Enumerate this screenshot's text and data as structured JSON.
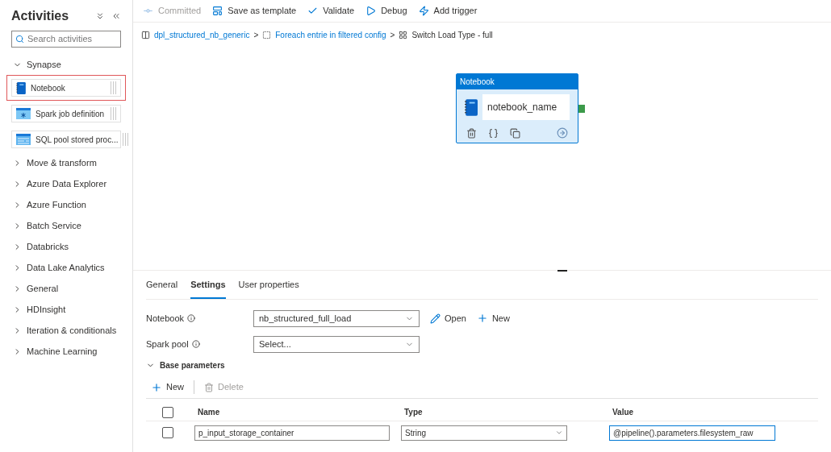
{
  "sidebar": {
    "title": "Activities",
    "search": {
      "placeholder": "Search activities"
    },
    "categories": [
      {
        "label": "Synapse",
        "expanded": true,
        "items": [
          {
            "label": "Notebook",
            "selected": true,
            "kind": "notebook"
          },
          {
            "label": "Spark job definition",
            "selected": false,
            "kind": "spark"
          },
          {
            "label": "SQL pool stored proc...",
            "selected": false,
            "kind": "sql"
          }
        ]
      },
      {
        "label": "Move & transform",
        "expanded": false
      },
      {
        "label": "Azure Data Explorer",
        "expanded": false
      },
      {
        "label": "Azure Function",
        "expanded": false
      },
      {
        "label": "Batch Service",
        "expanded": false
      },
      {
        "label": "Databricks",
        "expanded": false
      },
      {
        "label": "Data Lake Analytics",
        "expanded": false
      },
      {
        "label": "General",
        "expanded": false
      },
      {
        "label": "HDInsight",
        "expanded": false
      },
      {
        "label": "Iteration & conditionals",
        "expanded": false
      },
      {
        "label": "Machine Learning",
        "expanded": false
      }
    ]
  },
  "toolbar": [
    {
      "label": "Committed",
      "kind": "commit",
      "disabled": true
    },
    {
      "label": "Save as template",
      "kind": "template",
      "disabled": false
    },
    {
      "label": "Validate",
      "kind": "validate",
      "disabled": false
    },
    {
      "label": "Debug",
      "kind": "debug",
      "disabled": false
    },
    {
      "label": "Add trigger",
      "kind": "trigger",
      "disabled": false
    }
  ],
  "breadcrumb": [
    {
      "label": "dpl_structured_nb_generic",
      "kind": "pipeline",
      "link": true
    },
    {
      "label": "Foreach entrie in filtered config",
      "kind": "foreach",
      "link": true
    },
    {
      "label": "Switch Load Type - full",
      "kind": "switch",
      "link": false
    }
  ],
  "breadcrumb_separator": ">",
  "node": {
    "title": "Notebook",
    "name": "notebook_name"
  },
  "tabs": [
    {
      "label": "General",
      "selected": false
    },
    {
      "label": "Settings",
      "selected": true
    },
    {
      "label": "User properties",
      "selected": false
    }
  ],
  "settings": {
    "notebook": {
      "label": "Notebook",
      "value": "nb_structured_full_load",
      "actions": [
        {
          "label": "Open",
          "kind": "edit"
        },
        {
          "label": "New",
          "kind": "add"
        }
      ]
    },
    "spark_pool": {
      "label": "Spark pool",
      "placeholder": "Select..."
    }
  },
  "base_parameters": {
    "label": "Base parameters",
    "expanded": true,
    "actions": [
      {
        "label": "New",
        "kind": "add",
        "disabled": false
      },
      {
        "label": "Delete",
        "kind": "delete",
        "disabled": true
      }
    ],
    "table": {
      "select_all": {
        "checked": false
      },
      "columns": [
        "Name",
        "Type",
        "Value"
      ],
      "rows": [
        {
          "checked": false,
          "name": "p_input_storage_container",
          "type": "String",
          "value": "@pipeline().parameters.filesystem_raw"
        }
      ]
    }
  }
}
